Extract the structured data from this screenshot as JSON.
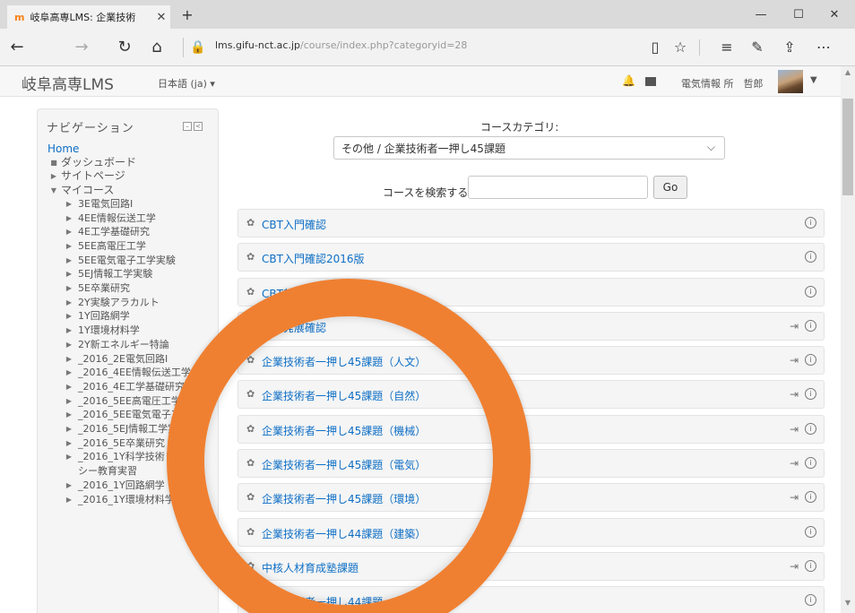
{
  "browser": {
    "tab_title": "岐阜高専LMS: 企業技術",
    "tab_close": "✕",
    "new_tab": "+",
    "favicon": "m",
    "win_minimize": "—",
    "win_maximize": "☐",
    "win_close": "✕",
    "url_host": "lms.gifu-nct.ac.jp",
    "url_path": "/course/index.php?categoryid=28"
  },
  "header": {
    "brand": "岐阜高専LMS",
    "language": "日本語 (ja) ▾",
    "username": "電気情報 所　哲郎"
  },
  "navigation": {
    "title": "ナビゲーション",
    "home": "Home",
    "top_items": [
      {
        "label": "ダッシュボード",
        "bullet": "■"
      },
      {
        "label": "サイトページ",
        "bullet": "▶"
      },
      {
        "label": "マイコース",
        "bullet": "▼"
      }
    ],
    "courses": [
      "3E電気回路I",
      "4EE情報伝送工学",
      "4E工学基礎研究",
      "5EE高電圧工学",
      "5EE電気電子工学実験",
      "5EJ情報工学実験",
      "5E卒業研究",
      "2Y実験アラカルト",
      "1Y回路網学",
      "1Y環境材料学",
      "2Y新エネルギー特論",
      "_2016_2E電気回路I",
      "_2016_4EE情報伝送工学",
      "_2016_4E工学基礎研究",
      "_2016_5EE高電圧工学",
      "_2016_5EE電気電子工学実験",
      "_2016_5EJ情報工学実験",
      "_2016_5E卒業研究",
      "_2016_1Y科学技術リテラシー教育実習",
      "_2016_1Y回路網学",
      "_2016_1Y環境材料学"
    ]
  },
  "main": {
    "category_label": "コースカテゴリ:",
    "category_selected": "その他 / 企業技術者一押し45課題",
    "search_label": "コースを検索する:",
    "search_value": "",
    "go_button": "Go",
    "courses": [
      {
        "name": "CBT入門確認",
        "enrol": false
      },
      {
        "name": "CBT入門確認2016版",
        "enrol": false
      },
      {
        "name": "CBT基礎確認",
        "enrol": false
      },
      {
        "name": "CBT発展確認",
        "enrol": true
      },
      {
        "name": "企業技術者一押し45課題（人文）",
        "enrol": true
      },
      {
        "name": "企業技術者一押し45課題（自然）",
        "enrol": true
      },
      {
        "name": "企業技術者一押し45課題（機械）",
        "enrol": true
      },
      {
        "name": "企業技術者一押し45課題（電気）",
        "enrol": true
      },
      {
        "name": "企業技術者一押し45課題（環境）",
        "enrol": true
      },
      {
        "name": "企業技術者一押し44課題（建築）",
        "enrol": false
      },
      {
        "name": "中核人材育成塾課題",
        "enrol": true
      },
      {
        "name": "企業技術者一押し44課題",
        "enrol": false
      }
    ]
  },
  "colors": {
    "link": "#0f6fc5",
    "accent_ring": "#ef7f31",
    "favicon": "#f98012"
  }
}
